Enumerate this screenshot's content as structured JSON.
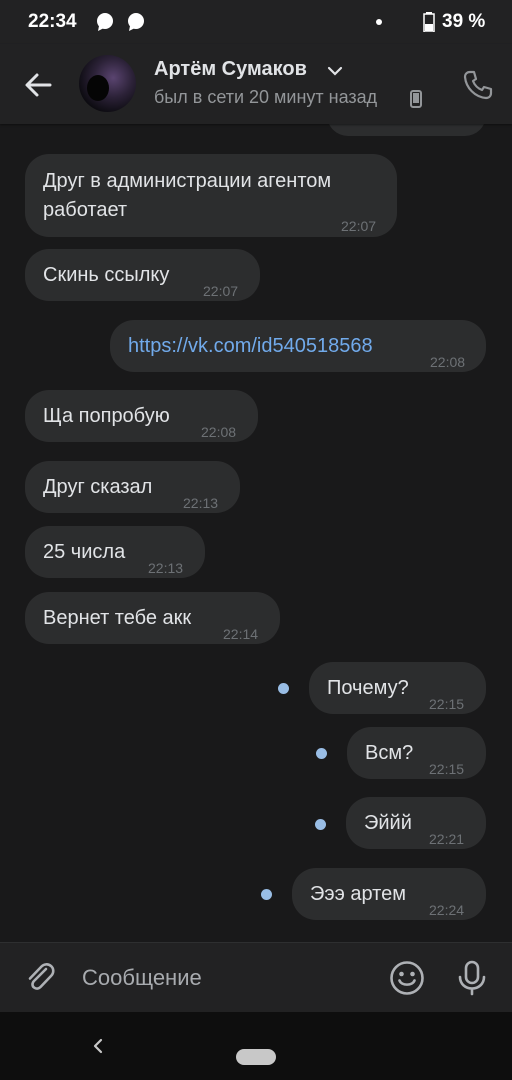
{
  "status_bar": {
    "time": "22:34",
    "battery": "39 %",
    "icons": [
      "message-bubble-icon",
      "message-bubble-icon",
      "notification-dot",
      "battery-icon"
    ]
  },
  "header": {
    "name": "Артём Сумаков",
    "status": "был в сети 20 минут назад",
    "icons": [
      "back-arrow-icon",
      "chevron-down-icon",
      "mobile-phone-icon",
      "phone-call-icon"
    ]
  },
  "messages": [
    {
      "dir": "in",
      "text_line1": "Друг в администрации агентом",
      "text_line2": "работает",
      "time": "22:07"
    },
    {
      "dir": "in",
      "text": "Скинь ссылку",
      "time": "22:07"
    },
    {
      "dir": "out",
      "text": "https://vk.com/id540518568",
      "time": "22:08",
      "is_link": true
    },
    {
      "dir": "in",
      "text": "Ща попробую",
      "time": "22:08"
    },
    {
      "dir": "in",
      "text": "Друг сказал",
      "time": "22:13"
    },
    {
      "dir": "in",
      "text": "25 числа",
      "time": "22:13"
    },
    {
      "dir": "in",
      "text": "Вернет тебе акк",
      "time": "22:14"
    },
    {
      "dir": "out",
      "text": "Почему?",
      "time": "22:15",
      "unread": true
    },
    {
      "dir": "out",
      "text": "Всм?",
      "time": "22:15",
      "unread": true
    },
    {
      "dir": "out",
      "text": "Эййй",
      "time": "22:21",
      "unread": true
    },
    {
      "dir": "out",
      "text": "Эээ артем",
      "time": "22:24",
      "unread": true
    }
  ],
  "composer": {
    "placeholder": "Сообщение",
    "icons": [
      "paperclip-icon",
      "emoji-smile-icon",
      "microphone-icon"
    ]
  },
  "colors": {
    "background": "#19191a",
    "bar": "#222223",
    "bubble": "#2c2d2e",
    "text": "#e1e3e6",
    "secondary": "#939699",
    "link": "#71aaeb",
    "unread_dot": "#99bde5"
  }
}
